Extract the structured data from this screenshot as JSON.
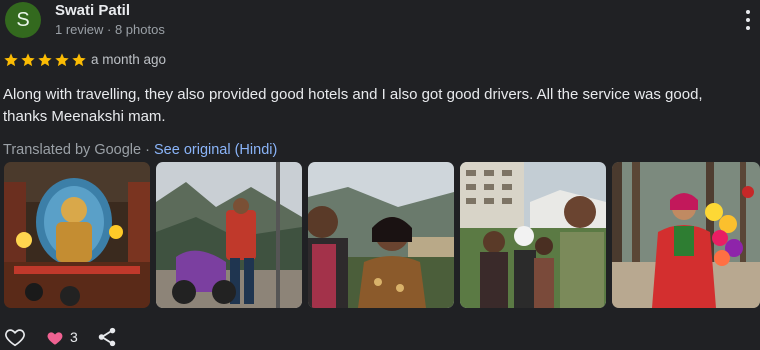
{
  "reviewer": {
    "avatar_letter": "S",
    "avatar_color": "#33691e",
    "name": "Swati Patil",
    "meta": "1 review · 8 photos"
  },
  "menu_icon": "more-vertical-icon",
  "rating": {
    "stars": 5,
    "max": 5,
    "star_color": "#fbbc04"
  },
  "time": "a month ago",
  "review_lines": [
    "Along with travelling, they also provided good hotels and I also got good drivers. All the service was good,",
    "thanks Meenakshi mam."
  ],
  "translation": {
    "label": "Translated by Google",
    "separator": " · ",
    "link": "See original (Hindi)",
    "link_color": "#8ab4f8"
  },
  "photos": [
    {
      "name": "photo-temple"
    },
    {
      "name": "photo-scooter-mountains"
    },
    {
      "name": "photo-couple-selfie"
    },
    {
      "name": "photo-family-hotel"
    },
    {
      "name": "photo-woman-flowers"
    }
  ],
  "footer": {
    "like_icon": "heart-outline-icon",
    "reactions_icon": "heart-filled-icon",
    "reactions_count": "3",
    "share_icon": "share-icon",
    "heart_color": "#f06292"
  }
}
